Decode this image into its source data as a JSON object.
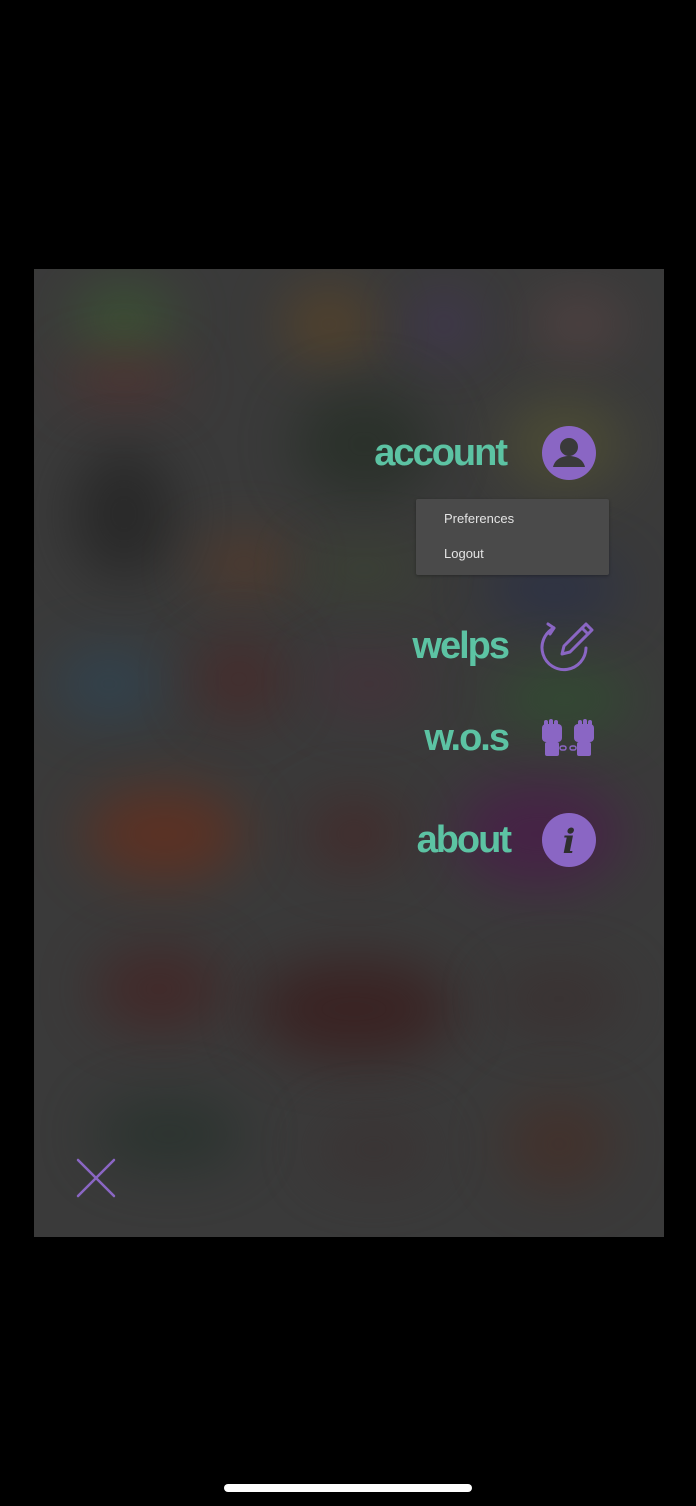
{
  "menu": {
    "account_label": "account",
    "welps_label": "welps",
    "wos_label": "w.o.s",
    "about_label": "about"
  },
  "account_dropdown": {
    "items": [
      "Preferences",
      "Logout"
    ]
  },
  "icons": {
    "account": "user-circle-icon",
    "welps": "refresh-pencil-icon",
    "wos": "fists-chain-icon",
    "about": "info-icon",
    "close": "close-icon"
  },
  "colors": {
    "label_green": "#5cc3a3",
    "accent_purple": "#8a66c4",
    "overlay_gray": "#3a3a3a",
    "dropdown_bg": "#4a4a4a"
  }
}
